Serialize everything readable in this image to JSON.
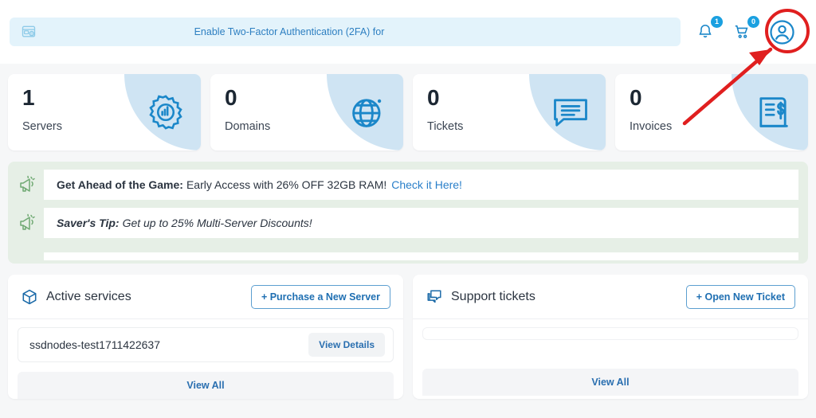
{
  "topbar": {
    "banner": {
      "icon": "two-factor-auth-icon",
      "text": "Enable Two-Factor Authentication (2FA) for"
    },
    "notifications": {
      "icon": "bell-icon",
      "badge": "1"
    },
    "cart": {
      "icon": "cart-icon",
      "badge": "0"
    },
    "avatar": {
      "icon": "user-avatar-icon",
      "highlight_color": "#e01f1f"
    }
  },
  "stats": [
    {
      "value": "1",
      "label": "Servers",
      "icon": "gear-chart-icon"
    },
    {
      "value": "0",
      "label": "Domains",
      "icon": "globe-icon"
    },
    {
      "value": "0",
      "label": "Tickets",
      "icon": "chat-bubble-icon"
    },
    {
      "value": "0",
      "label": "Invoices",
      "icon": "invoice-dollar-icon"
    }
  ],
  "promos": [
    {
      "icon": "megaphone-icon",
      "bold": "Get Ahead of the Game:",
      "rest": "Early Access with 26% OFF 32GB RAM!",
      "link": "Check it Here!"
    },
    {
      "icon": "megaphone-icon",
      "bold": "Saver's Tip:",
      "rest": "Get up to 25% Multi-Server Discounts!",
      "link": ""
    }
  ],
  "services_panel": {
    "icon": "cube-icon",
    "title": "Active services",
    "action_label": "+ Purchase a New Server",
    "rows": [
      {
        "name": "ssdnodes-test1711422637",
        "action": "View Details"
      }
    ],
    "view_all": "View All"
  },
  "tickets_panel": {
    "icon": "tickets-icon",
    "title": "Support tickets",
    "action_label": "+ Open New Ticket",
    "rows": [],
    "view_all": "View All"
  },
  "colors": {
    "page_bg": "#f6f7f8",
    "accent_blue": "#1b87c9",
    "banner_bg": "#e3f3fb",
    "promo_bg": "#e6efe6",
    "annotation_red": "#e01f1f"
  }
}
